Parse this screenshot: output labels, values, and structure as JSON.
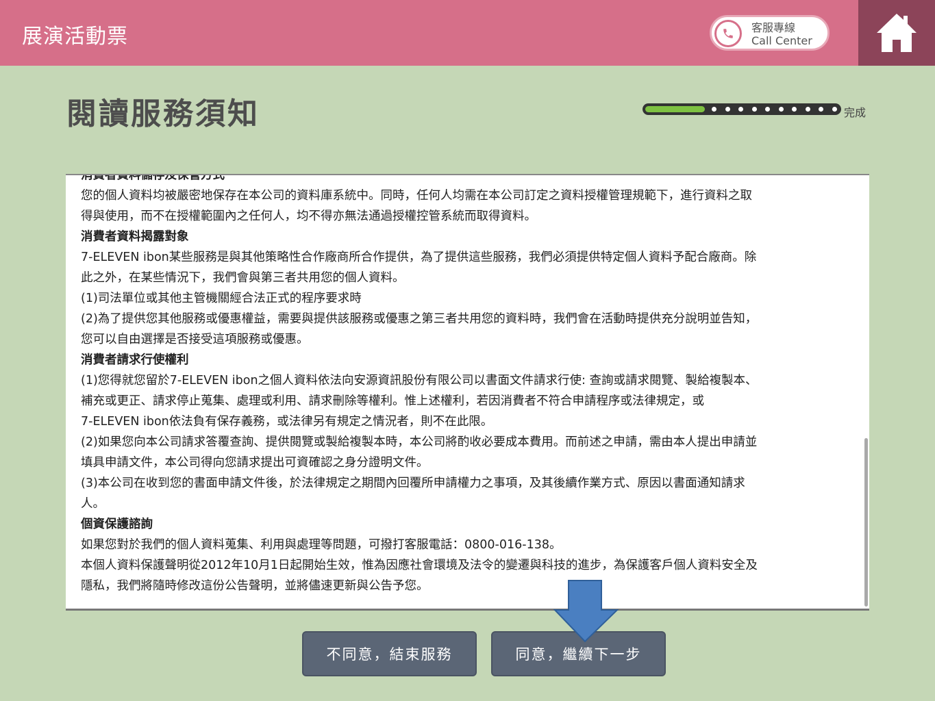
{
  "header": {
    "title": "展演活動票",
    "call_center_line1": "客服專線",
    "call_center_line2": "Call Center"
  },
  "page": {
    "title": "閱讀服務須知",
    "progress_label": "完成",
    "progress_fraction": 0.3
  },
  "notice": {
    "lines": [
      {
        "text": "消費者資料儲存及保管方式",
        "bold": true
      },
      {
        "text": "您的個人資料均被嚴密地保存在本公司的資料庫系統中。同時，任何人均需在本公司訂定之資料授權管理規範下，進行資料之取",
        "bold": false
      },
      {
        "text": "得與使用，而不在授權範圍內之任何人，均不得亦無法通過授權控管系統而取得資料。",
        "bold": false
      },
      {
        "text": "消費者資料揭露對象",
        "bold": true
      },
      {
        "text": "7-ELEVEN ibon某些服務是與其他策略性合作廠商所合作提供，為了提供這些服務，我們必須提供特定個人資料予配合廠商。除",
        "bold": false
      },
      {
        "text": "此之外，在某些情況下，我們會與第三者共用您的個人資料。",
        "bold": false
      },
      {
        "text": "(1)司法單位或其他主管機關經合法正式的程序要求時",
        "bold": false
      },
      {
        "text": "(2)為了提供您其他服務或優惠權益，需要與提供該服務或優惠之第三者共用您的資料時，我們會在活動時提供充分說明並告知，",
        "bold": false
      },
      {
        "text": "您可以自由選擇是否接受這項服務或優惠。",
        "bold": false
      },
      {
        "text": "消費者請求行使權利",
        "bold": true
      },
      {
        "text": "(1)您得就您留於7-ELEVEN ibon之個人資料依法向安源資訊股份有限公司以書面文件請求行使: 查詢或請求閱覽、製給複製本、",
        "bold": false
      },
      {
        "text": "補充或更正、請求停止蒐集、處理或利用、請求刪除等權利。惟上述權利，若因消費者不符合申請程序或法律規定，或",
        "bold": false
      },
      {
        "text": "7-ELEVEN ibon依法負有保存義務，或法律另有規定之情況者，則不在此限。",
        "bold": false
      },
      {
        "text": "(2)如果您向本公司請求答覆查詢、提供閱覽或製給複製本時，本公司將酌收必要成本費用。而前述之申請，需由本人提出申請並",
        "bold": false
      },
      {
        "text": "填具申請文件，本公司得向您請求提出可資確認之身分證明文件。",
        "bold": false
      },
      {
        "text": "(3)本公司在收到您的書面申請文件後，於法律規定之期間內回覆所申請權力之事項，及其後續作業方式、原因以書面通知請求",
        "bold": false
      },
      {
        "text": "人。",
        "bold": false
      },
      {
        "text": "個資保護諮詢",
        "bold": true
      },
      {
        "text": "如果您對於我們的個人資料蒐集、利用與處理等問題，可撥打客服電話：0800-016-138。",
        "bold": false
      },
      {
        "text": "本個人資料保護聲明從2012年10月1日起開始生效，惟為因應社會環境及法令的變遷與科技的進步，為保護客戶個人資料安全及",
        "bold": false
      },
      {
        "text": "隱私，我們將隨時修改這份公告聲明，並將儘速更新與公告予您。",
        "bold": false
      }
    ]
  },
  "buttons": {
    "decline": "不同意，結束服務",
    "agree": "同意，繼續下一步"
  },
  "colors": {
    "header_bg": "#d66f89",
    "home_bg": "#8c4459",
    "page_bg": "#c5d7b6",
    "button_bg": "#5b6676",
    "progress_fill": "#7ec142",
    "arrow": "#4a7fc1"
  },
  "icons": [
    "phone-icon",
    "home-icon",
    "down-arrow-icon"
  ]
}
